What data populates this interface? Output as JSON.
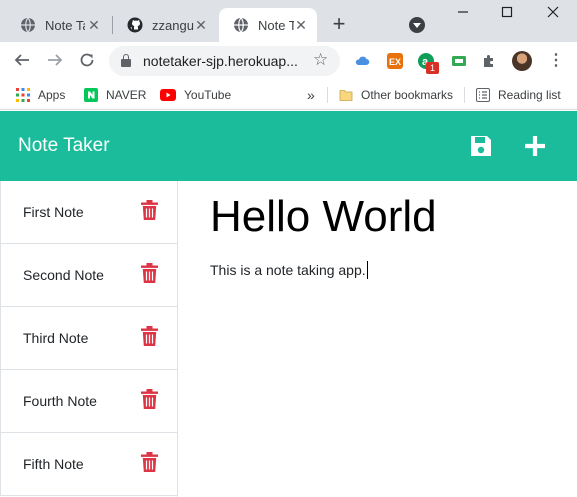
{
  "browser": {
    "tabs": [
      {
        "title": "Note Taker",
        "icon": "globe-icon",
        "active": false
      },
      {
        "title": "zzangu",
        "icon": "github-icon",
        "active": false
      },
      {
        "title": "Note Taker",
        "icon": "globe-icon",
        "active": true
      }
    ],
    "close_glyph": "✕",
    "new_tab_glyph": "+",
    "url": "notetaker-sjp.herokuap...",
    "extension_badge": "1",
    "bookmarks": [
      {
        "label": "Apps",
        "icon": "apps-grid-icon"
      },
      {
        "label": "NAVER",
        "icon": "naver-icon"
      },
      {
        "label": "YouTube",
        "icon": "youtube-icon"
      }
    ],
    "overflow_glyph": "»",
    "other_bookmarks": "Other bookmarks",
    "reading_list": "Reading list"
  },
  "app": {
    "brand": "Note Taker",
    "save_icon": "floppy-disk-icon",
    "new_icon": "plus-icon",
    "accent_color": "#1abc9c",
    "delete_color": "#dc3545",
    "notes": [
      {
        "title": "First Note"
      },
      {
        "title": "Second Note"
      },
      {
        "title": "Third Note"
      },
      {
        "title": "Fourth Note"
      },
      {
        "title": "Fifth Note"
      }
    ],
    "active_note": {
      "title": "Hello World",
      "text": "This is a note taking app."
    }
  }
}
